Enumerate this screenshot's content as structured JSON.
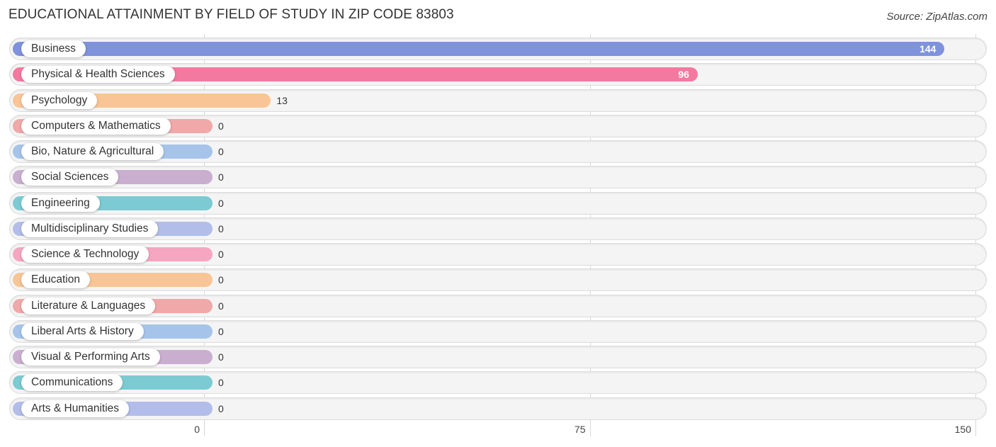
{
  "header": {
    "title": "EDUCATIONAL ATTAINMENT BY FIELD OF STUDY IN ZIP CODE 83803",
    "source": "Source: ZipAtlas.com"
  },
  "chart_data": {
    "type": "bar",
    "orientation": "horizontal",
    "title": "EDUCATIONAL ATTAINMENT BY FIELD OF STUDY IN ZIP CODE 83803",
    "xlabel": "",
    "ylabel": "",
    "xlim": [
      0,
      150
    ],
    "xticks": [
      0,
      75,
      150
    ],
    "grid": true,
    "categories": [
      "Business",
      "Physical & Health Sciences",
      "Psychology",
      "Computers & Mathematics",
      "Bio, Nature & Agricultural",
      "Social Sciences",
      "Engineering",
      "Multidisciplinary Studies",
      "Science & Technology",
      "Education",
      "Literature & Languages",
      "Liberal Arts & History",
      "Visual & Performing Arts",
      "Communications",
      "Arts & Humanities"
    ],
    "values": [
      144,
      96,
      13,
      0,
      0,
      0,
      0,
      0,
      0,
      0,
      0,
      0,
      0,
      0,
      0
    ],
    "colors": [
      "#7f92dc",
      "#f27aa0",
      "#f9c596",
      "#f0a8a8",
      "#a6c4ea",
      "#c9aed0",
      "#7ccbd2",
      "#b3bdea",
      "#f6a6c0",
      "#f9c596",
      "#f0a8a8",
      "#a6c4ea",
      "#c9aed0",
      "#7ccbd2",
      "#b3bdea"
    ]
  }
}
